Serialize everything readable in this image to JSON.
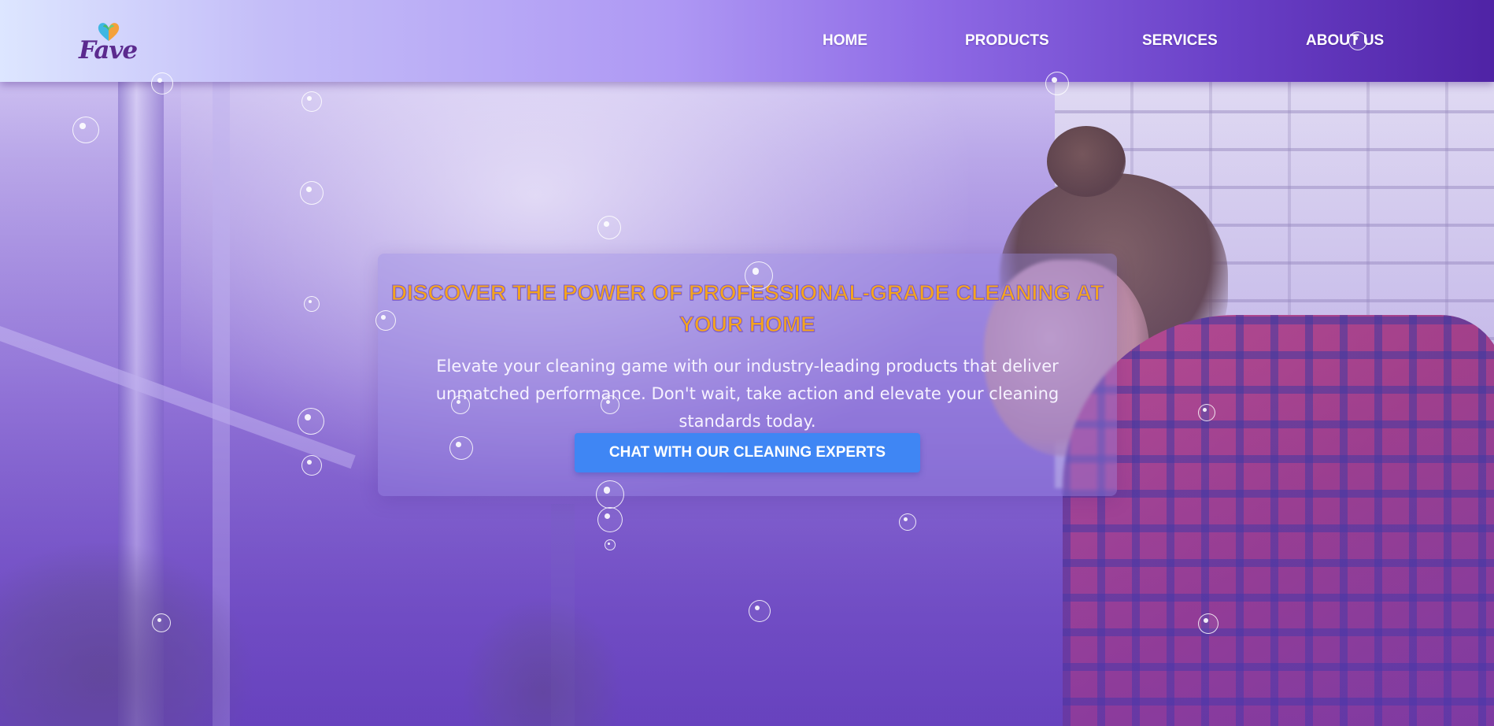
{
  "header": {
    "logo": {
      "text": "Fave",
      "icon": "heart-icon",
      "colors": {
        "text": "#5b2a8e",
        "heart_left": "#3fb7e3",
        "heart_right": "#f4a13a",
        "heart_leaf": "#4cb96b"
      }
    },
    "nav": [
      {
        "label": "HOME"
      },
      {
        "label": "PRODUCTS"
      },
      {
        "label": "SERVICES"
      },
      {
        "label": "ABOUT US"
      }
    ]
  },
  "hero": {
    "headline": "DISCOVER THE POWER OF PROFESSIONAL-GRADE CLEANING AT YOUR HOME",
    "subtext": "Elevate your cleaning game with our industry-leading products that deliver unmatched performance. Don't wait, take action and elevate your cleaning standards today.",
    "cta_label": "CHAT WITH OUR CLEANING EXPERTS",
    "decoration": "bubble-icon"
  },
  "colors": {
    "headline": "#f3a51e",
    "headline_outline": "#7b5bd2",
    "cta_background": "#3f86f4",
    "header_gradient_start": "#dde6ff",
    "header_gradient_end": "#4f23a5"
  }
}
